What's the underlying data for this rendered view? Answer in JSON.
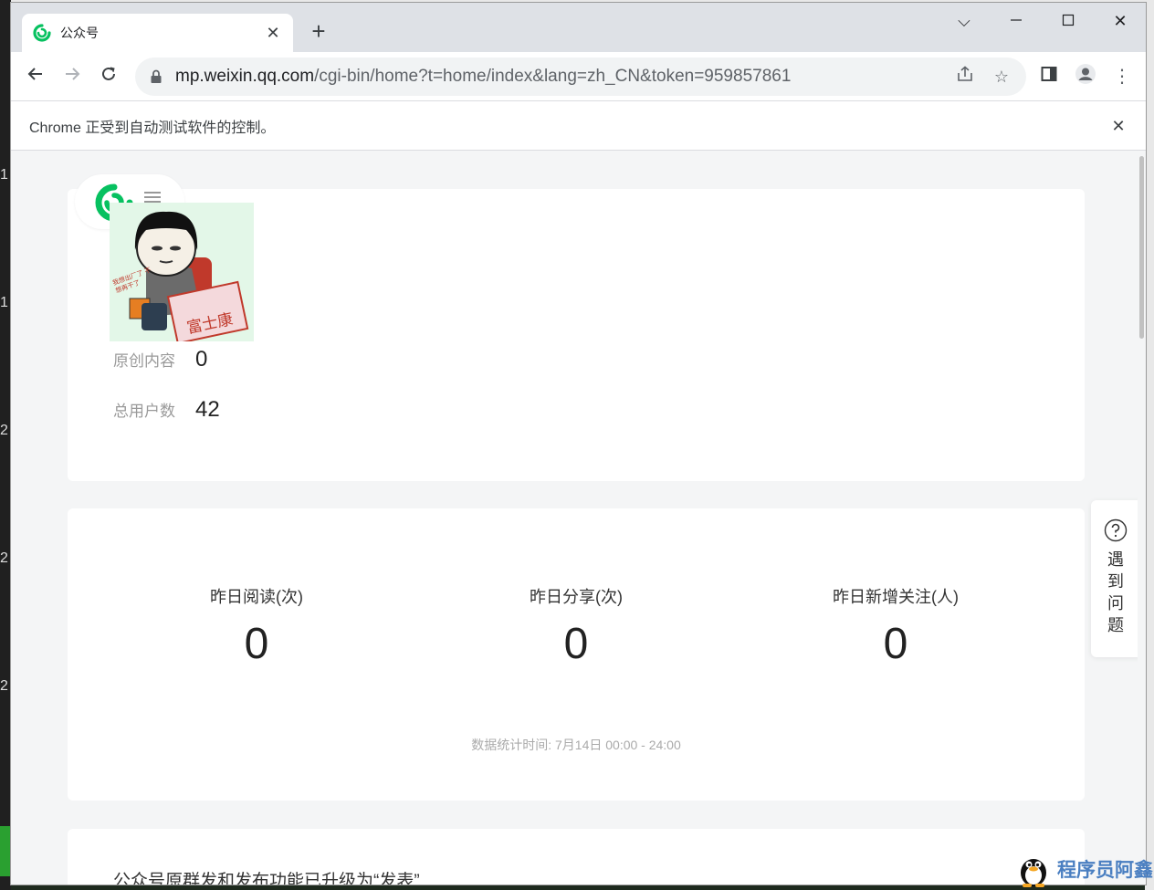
{
  "browser": {
    "tab_title": "公众号",
    "url_host": "mp.weixin.qq.com",
    "url_path": "/cgi-bin/home?t=home/index&lang=zh_CN&token=959857861",
    "infobar_text": "Chrome 正受到自动测试软件的控制。"
  },
  "account": {
    "stats": [
      {
        "label": "原创内容",
        "value": "0"
      },
      {
        "label": "总用户数",
        "value": "42"
      }
    ],
    "avatar_caption": "富士康",
    "avatar_small_text": "我想出厂了 不想再干了"
  },
  "yesterday": {
    "metrics": [
      {
        "label": "昨日阅读(次)",
        "value": "0"
      },
      {
        "label": "昨日分享(次)",
        "value": "0"
      },
      {
        "label": "昨日新增关注(人)",
        "value": "0"
      }
    ],
    "stat_time": "数据统计时间: 7月14日 00:00 - 24:00"
  },
  "notice": {
    "text": "公众号原群发和发布功能已升级为“发表”"
  },
  "help": {
    "text": "遇到问题"
  },
  "watermark": {
    "text": "程序员阿鑫"
  },
  "colors": {
    "wechat_green": "#07c160",
    "page_bg": "#f4f5f6"
  },
  "background_marks": [
    "1",
    "1",
    "2",
    "2",
    "2"
  ]
}
